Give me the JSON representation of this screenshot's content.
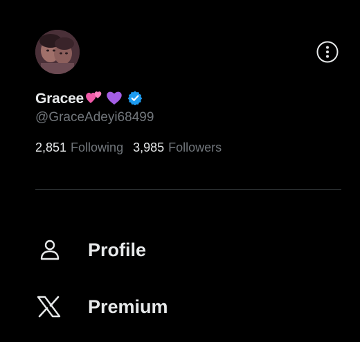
{
  "profile": {
    "display_name": "Gracee",
    "handle": "@GraceAdeyi68499",
    "verified": true,
    "verified_color": "#1d9bf0",
    "emoji": [
      "two-hearts-emoji",
      "purple-heart-emoji"
    ]
  },
  "stats": {
    "following_count": "2,851",
    "following_label": "Following",
    "followers_count": "3,985",
    "followers_label": "Followers"
  },
  "menu": {
    "items": [
      {
        "label": "Profile",
        "icon": "person-icon"
      },
      {
        "label": "Premium",
        "icon": "x-logo-icon"
      }
    ]
  },
  "colors": {
    "background": "#000000",
    "primary_text": "#e7e9ea",
    "secondary_text": "#71767b",
    "divider": "#2f3336"
  }
}
